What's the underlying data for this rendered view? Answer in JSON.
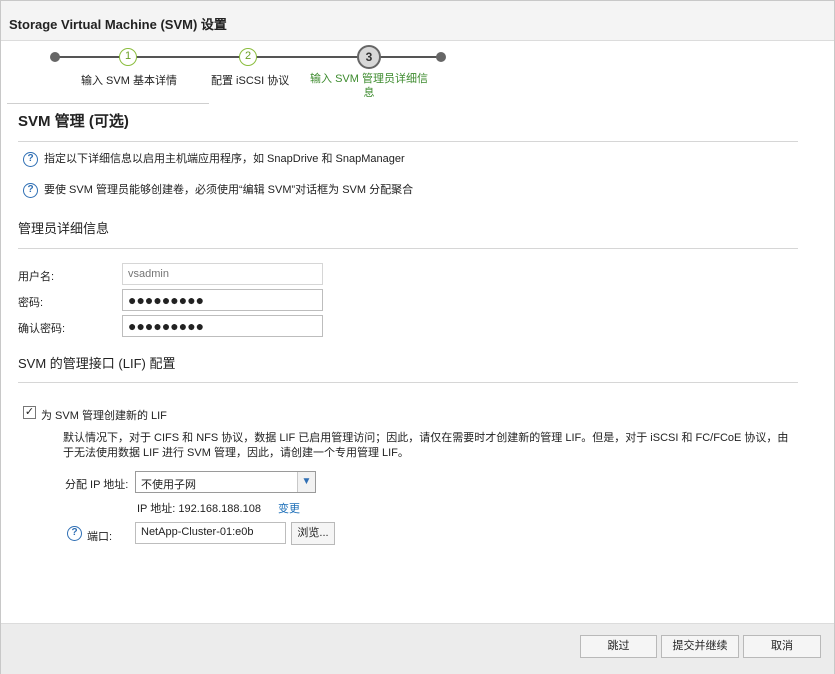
{
  "window": {
    "title": "Storage Virtual Machine (SVM) 设置"
  },
  "wizard": {
    "steps": [
      {
        "number": "1",
        "label": "输入 SVM 基本详情",
        "state": "done"
      },
      {
        "number": "2",
        "label": "配置 iSCSI 协议",
        "state": "done"
      },
      {
        "number": "3",
        "label_line1": "输入 SVM 管理员详细信",
        "label_line2": "息",
        "state": "active"
      }
    ]
  },
  "page": {
    "title": "SVM 管理 (可选)",
    "help_items": [
      "指定以下详细信息以启用主机端应用程序，如 SnapDrive 和 SnapManager",
      "要使 SVM 管理员能够创建卷，必须使用“编辑 SVM”对话框为 SVM 分配聚合"
    ],
    "admin_section": {
      "heading": "管理员详细信息",
      "username_label": "用户名:",
      "username_placeholder": "vsadmin",
      "password_label": "密码:",
      "password_value": "●●●●●●●●●",
      "confirm_label": "确认密码:",
      "confirm_value": "●●●●●●●●●"
    },
    "lif_section": {
      "heading": "SVM 的管理接口 (LIF) 配置",
      "checkbox_label": "为 SVM 管理创建新的 LIF",
      "checkbox_checked": true,
      "description": "默认情况下，对于 CIFS 和 NFS 协议，数据 LIF 已启用管理访问；因此，请仅在需要时才创建新的管理 LIF。但是，对于 iSCSI 和 FC/FCoE 协议，由于无法使用数据 LIF 进行 SVM 管理，因此，请创建一个专用管理 LIF。",
      "assign_ip_label": "分配 IP 地址:",
      "assign_ip_value": "不使用子网",
      "ip_text": "IP 地址: 192.168.188.108",
      "change_link": "变更",
      "port_label": "端口:",
      "port_value": "NetApp-Cluster-01:e0b",
      "browse_button": "浏览..."
    }
  },
  "footer": {
    "skip": "跳过",
    "submit": "提交并继续",
    "cancel": "取消"
  },
  "colors": {
    "step_done": "#8bbd3e",
    "step_active_label": "#3d8b2e",
    "help_icon": "#2f6fb4",
    "link": "#1d6fb8"
  }
}
